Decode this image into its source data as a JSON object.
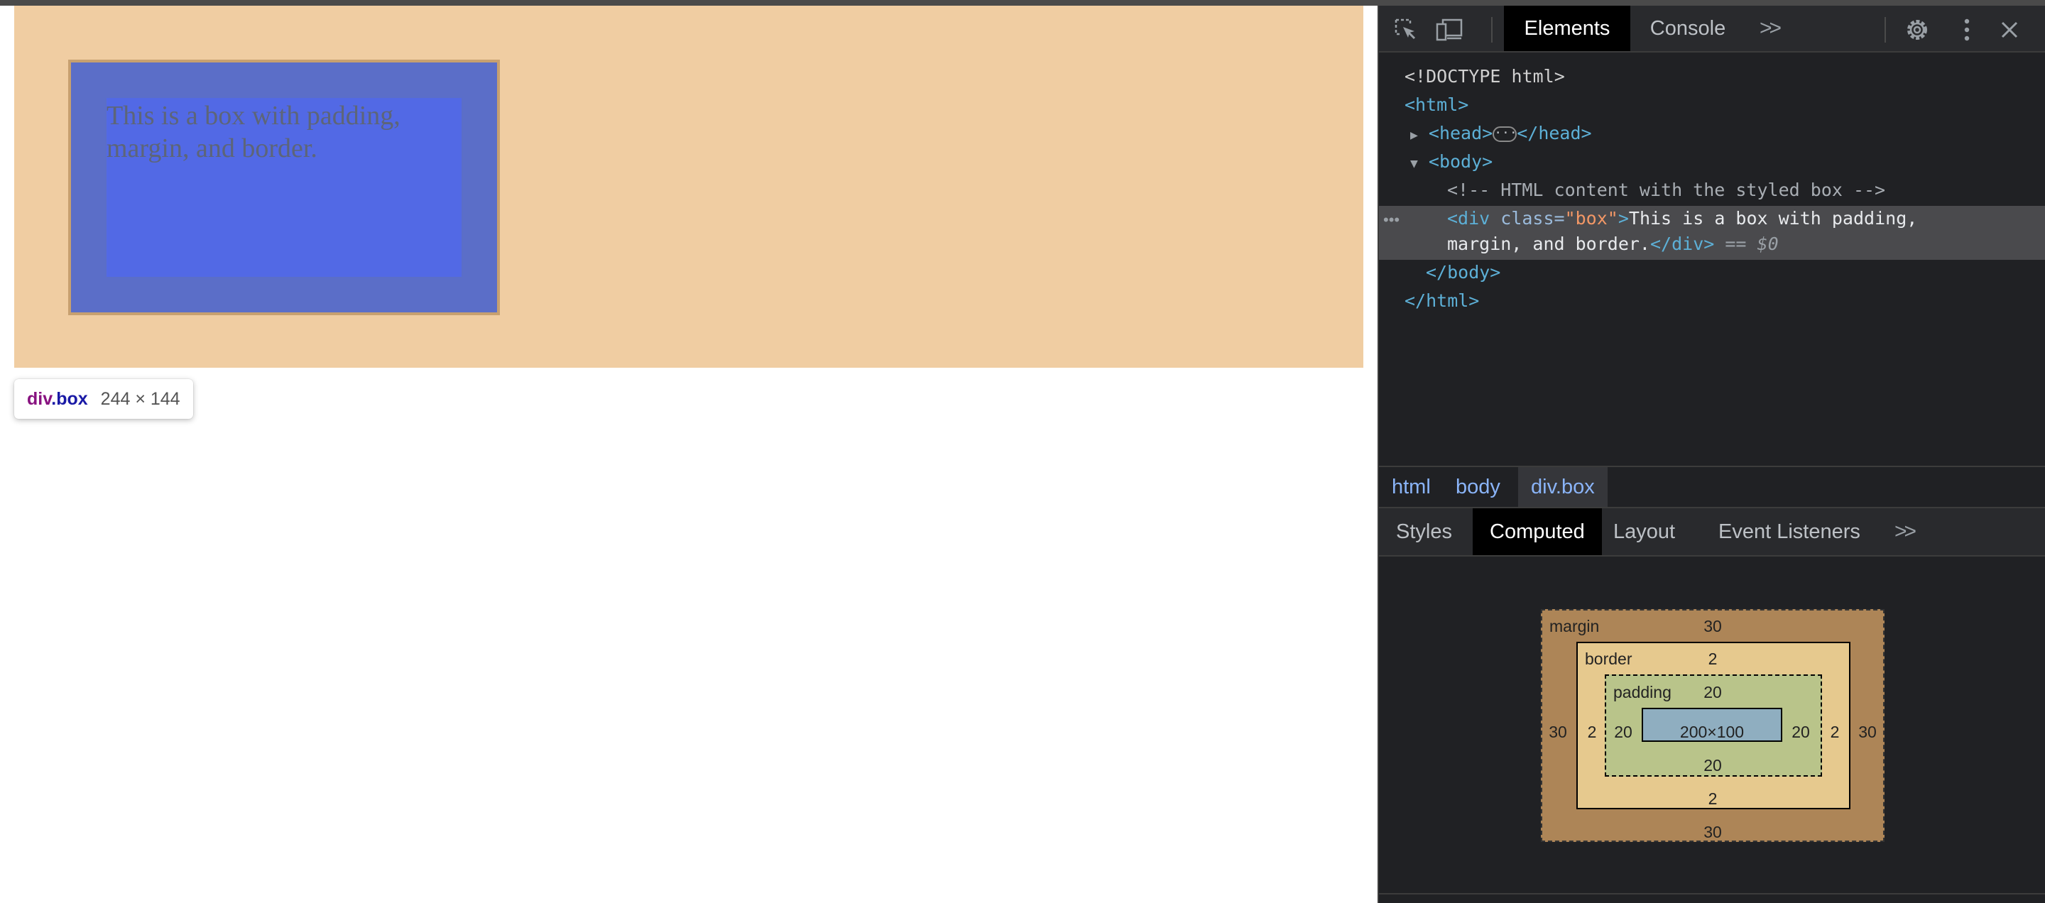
{
  "page": {
    "box_text": "This is a box with padding, margin, and border.",
    "tooltip": {
      "tag": "div",
      "class": ".box",
      "dims": "244 × 144"
    }
  },
  "devtools": {
    "tabs": [
      "Elements",
      "Console"
    ],
    "active_tab": "Elements",
    "dom": {
      "doctype": "<!DOCTYPE html>",
      "html_open": "<html>",
      "head_open": "<head>",
      "head_close": "</head>",
      "body_open": "<body>",
      "comment": "<!-- HTML content with the styled box -->",
      "div_open_start": "<div ",
      "div_attr_name": "class=",
      "div_attr_value": "\"box\"",
      "div_open_end": ">",
      "div_text_line1": "This is a box with padding,",
      "div_text_line2": "margin, and border.",
      "div_close": "</div>",
      "selected_marker": " == ",
      "dollar": "$0",
      "body_close": "</body>",
      "html_close": "</html>"
    },
    "breadcrumb": [
      "html",
      "body",
      "div.box"
    ],
    "subtabs": [
      "Styles",
      "Computed",
      "Layout",
      "Event Listeners"
    ],
    "active_subtab": "Computed",
    "box_model": {
      "margin_label": "margin",
      "border_label": "border",
      "padding_label": "padding",
      "margin": {
        "top": "30",
        "right": "30",
        "bottom": "30",
        "left": "30"
      },
      "border": {
        "top": "2",
        "right": "2",
        "bottom": "2",
        "left": "2"
      },
      "padding": {
        "top": "20",
        "right": "20",
        "bottom": "20",
        "left": "20"
      },
      "content": "200×100"
    }
  },
  "colors": {
    "margin_overlay": "#f0cda2",
    "box_background": "#5269e5",
    "devtools_bg": "#202124"
  },
  "icons": [
    "inspect-element-icon",
    "device-toolbar-icon",
    "more-tabs-icon",
    "settings-gear-icon",
    "kebab-menu-icon",
    "close-icon"
  ]
}
